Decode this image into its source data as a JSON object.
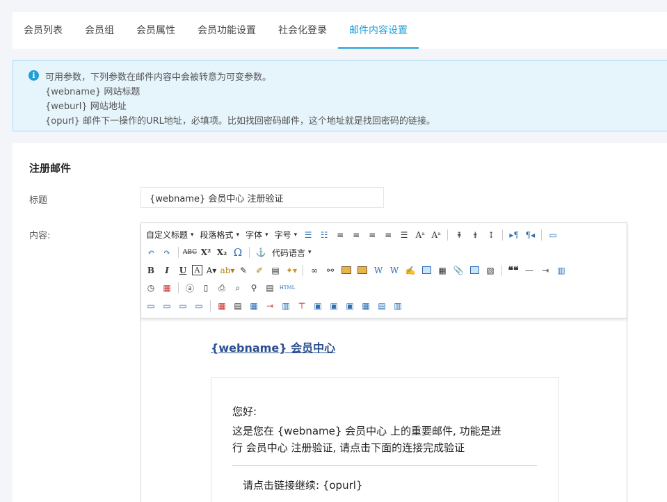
{
  "tabs": [
    {
      "label": "会员列表"
    },
    {
      "label": "会员组"
    },
    {
      "label": "会员属性"
    },
    {
      "label": "会员功能设置"
    },
    {
      "label": "社会化登录"
    },
    {
      "label": "邮件内容设置",
      "active": true
    }
  ],
  "notice": {
    "icon": "info-icon",
    "lines": [
      "可用参数，下列参数在邮件内容中会被转意为可变参数。",
      "{webname} 网站标题",
      "{weburl} 网站地址",
      "{opurl} 邮件下一操作的URL地址，必填项。比如找回密码邮件，这个地址就是找回密码的链接。"
    ]
  },
  "section": {
    "title": "注册邮件",
    "subject_label": "标题",
    "subject_value": "{webname} 会员中心 注册验证",
    "content_label": "内容:"
  },
  "toolbar": {
    "custom_title": "自定义标题",
    "paragraph": "段落格式",
    "font": "字体",
    "font_size": "字号",
    "code_lang": "代码语言",
    "html_label": "HTML",
    "superscript": "X²",
    "subscript": "X₂",
    "strike": "ABC",
    "omega": "Ω",
    "quote": "❝❝"
  },
  "email": {
    "heading": "{webname} 会员中心",
    "greeting": "您好:",
    "body_line1": "这是您在 {webname} 会员中心 上的重要邮件, 功能是进",
    "body_line2": "行 会员中心 注册验证, 请点击下面的连接完成验证",
    "continue_text": "请点击链接继续: {opurl}"
  },
  "colors": {
    "accent": "#1e9fd8",
    "notice_bg": "#e6f4fc",
    "link": "#2a4f8f"
  }
}
